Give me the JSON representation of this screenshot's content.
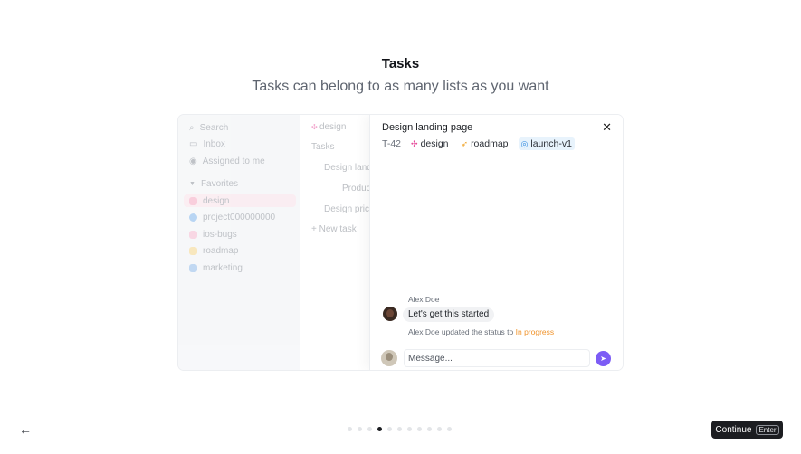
{
  "header": {
    "title": "Tasks",
    "subtitle": "Tasks can belong to as many lists as you want"
  },
  "sidebar": {
    "items": [
      {
        "label": "Search",
        "icon": "search-icon"
      },
      {
        "label": "Inbox",
        "icon": "inbox-icon"
      },
      {
        "label": "Assigned to me",
        "icon": "user-icon"
      },
      {
        "label": "Favorites",
        "icon": "chevron-down-icon"
      },
      {
        "label": "design",
        "icon": "design-icon",
        "color": "#f4a6c0"
      },
      {
        "label": "project000000000",
        "icon": "globe-icon",
        "color": "#7fb3ea"
      },
      {
        "label": "ios-bugs",
        "icon": "bug-icon",
        "color": "#f4b8cf"
      },
      {
        "label": "roadmap",
        "icon": "rocket-icon",
        "color": "#f3d58a"
      },
      {
        "label": "marketing",
        "icon": "chart-icon",
        "color": "#8fb9e8"
      }
    ]
  },
  "list": {
    "header": "design",
    "section": "Tasks",
    "rows": [
      "Design landing page",
      "Product page",
      "Design pricing page"
    ],
    "new_task": "New task"
  },
  "detail": {
    "title": "Design landing page",
    "task_id": "T-42",
    "tags": [
      {
        "label": "design",
        "icon": "✣",
        "color": "#e64a9a"
      },
      {
        "label": "roadmap",
        "icon": "🚀",
        "color": "#f0a020"
      },
      {
        "label": "launch-v1",
        "icon": "◎",
        "color": "#2f8ae0"
      }
    ],
    "comment": {
      "author": "Alex Doe",
      "text": "Let's get this started",
      "status_prefix": "Alex Doe updated the status to",
      "status_value": "In progress"
    },
    "composer": {
      "placeholder": "Message..."
    }
  },
  "footer": {
    "continue_label": "Continue",
    "continue_shortcut": "Enter",
    "dots_total": 11,
    "dots_active": 3
  }
}
